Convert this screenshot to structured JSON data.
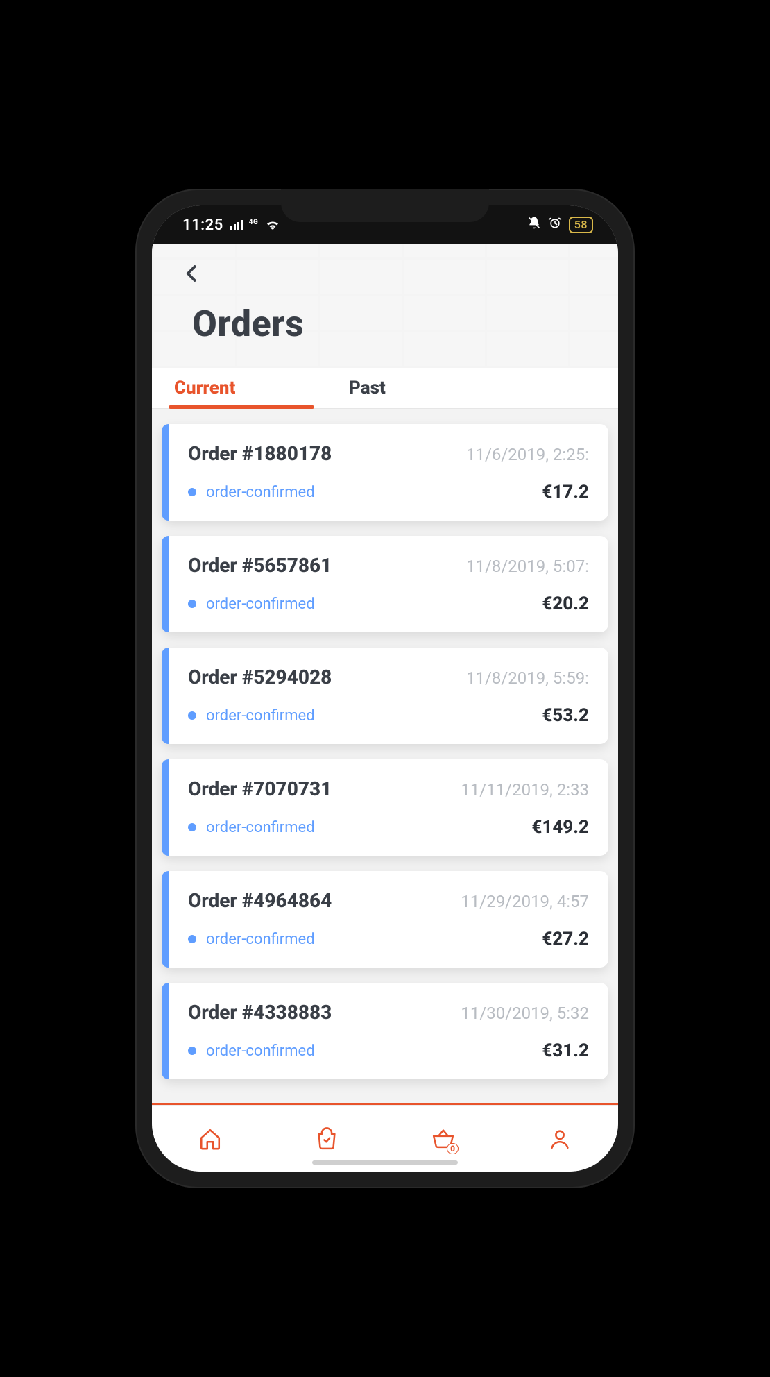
{
  "status_bar": {
    "time": "11:25",
    "network_label": "4G",
    "battery": "58"
  },
  "header": {
    "title": "Orders",
    "back_icon": "chevron-left"
  },
  "tabs": {
    "current": "Current",
    "past": "Past",
    "active": "current"
  },
  "orders": [
    {
      "title": "Order #1880178",
      "date": "11/6/2019, 2:25:",
      "status": "order-confirmed",
      "price": "€17.2"
    },
    {
      "title": "Order #5657861",
      "date": "11/8/2019, 5:07:",
      "status": "order-confirmed",
      "price": "€20.2"
    },
    {
      "title": "Order #5294028",
      "date": "11/8/2019, 5:59:",
      "status": "order-confirmed",
      "price": "€53.2"
    },
    {
      "title": "Order #7070731",
      "date": "11/11/2019, 2:33",
      "status": "order-confirmed",
      "price": "€149.2"
    },
    {
      "title": "Order #4964864",
      "date": "11/29/2019, 4:57",
      "status": "order-confirmed",
      "price": "€27.2"
    },
    {
      "title": "Order #4338883",
      "date": "11/30/2019, 5:32",
      "status": "order-confirmed",
      "price": "€31.2"
    }
  ],
  "nav": {
    "home": "home-icon",
    "bag": "bag-icon",
    "basket": "basket-icon",
    "basket_badge": "0",
    "profile": "profile-icon"
  },
  "colors": {
    "accent": "#e8542c",
    "card_accent": "#5f9dff"
  }
}
